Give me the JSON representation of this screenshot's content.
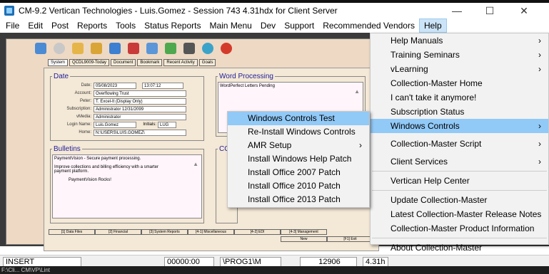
{
  "window": {
    "title": "CM-9.2 Vertican Technologies - Luis.Gomez - Session 743 4.31hdx for Client Server",
    "minimize": "—",
    "maximize": "☐",
    "close": "✕"
  },
  "menubar": [
    "File",
    "Edit",
    "Post",
    "Reports",
    "Tools",
    "Status Reports",
    "Main Menu",
    "Dev",
    "Support",
    "Recommended Vendors",
    "Help"
  ],
  "tabs": [
    "System",
    "QCDL9009-Today",
    "Document",
    "Bookmark",
    "Recent Activity",
    "Goals"
  ],
  "date_group": {
    "legend": "Date",
    "rows": [
      {
        "label": "Date:",
        "value": "05/08/2023",
        "extra": "13:07:12"
      },
      {
        "label": "Account:",
        "value": "Overflowing Trust"
      },
      {
        "label": "Peter:",
        "value": "T. Excel-It (Display Only)"
      },
      {
        "label": "Subscription:",
        "value": "Administrator 12/31/2099"
      },
      {
        "label": "vMedia:",
        "value": "Administrator"
      },
      {
        "label": "Login Name:",
        "value": "Luis.Gomez",
        "extra_label": "Initials:",
        "extra": "LUG"
      },
      {
        "label": "Home:",
        "value": "N:\\USERS\\LUIS.GOMEZ\\"
      }
    ]
  },
  "word_processing": {
    "legend": "Word Processing",
    "text": "WordPerfect Letters Pending"
  },
  "bulletins": {
    "legend": "Bulletins",
    "line1": "PaymentVision - Secure payment processing.",
    "line2": "Improve collections and billing efficiency with a smarter payment platform.",
    "line3": "PaymentVision Rocks!"
  },
  "cca_legend": "CCA",
  "bottom_buttons": [
    "[1] Data Files",
    "[2] Financial",
    "[3] System Reports",
    "[4-1] Miscellaneous",
    "[4-2] EDI",
    "[4-3] Management"
  ],
  "bottom_buttons2": [
    "New",
    "[F1] Exit"
  ],
  "help_menu": {
    "items": [
      {
        "label": "Help Manuals",
        "arrow": "›"
      },
      {
        "label": "Training Seminars",
        "arrow": "›"
      },
      {
        "label": "vLearning",
        "arrow": "›"
      },
      {
        "label": "Collection-Master Home"
      },
      {
        "label": "I can't take it anymore!"
      },
      {
        "label": "Subscription Status"
      },
      {
        "label": "Windows Controls",
        "arrow": "›",
        "highlight": true
      },
      {
        "label": "Collection-Master Script",
        "arrow": "›"
      },
      {
        "label": "Client Services",
        "arrow": "›"
      },
      {
        "label": "Vertican Help Center"
      },
      {
        "label": "Update Collection-Master"
      },
      {
        "label": "Latest Collection-Master Release Notes"
      },
      {
        "label": "Collection-Master Product Information"
      },
      {
        "label": "About Collection-Master"
      }
    ]
  },
  "windows_controls_menu": {
    "items": [
      {
        "label": "Windows Controls Test",
        "highlight": true
      },
      {
        "label": "Re-Install Windows Controls"
      },
      {
        "label": "AMR Setup",
        "arrow": "›"
      },
      {
        "label": "Install Windows Help Patch"
      },
      {
        "label": "Install Office 2007 Patch"
      },
      {
        "label": "Install Office 2010 Patch"
      },
      {
        "label": "Install Office 2013 Patch"
      }
    ]
  },
  "statusbar": {
    "mode": "INSERT",
    "time": "00000:00",
    "path": "\\PROG1\\M",
    "number": "12906",
    "version": "4.31h"
  },
  "bottom_text": "F:\\Cli... CM\\VP\\Lint",
  "colors": {
    "highlight": "#91c9f7",
    "panel": "#f4e8d6",
    "legend": "#20209a"
  }
}
